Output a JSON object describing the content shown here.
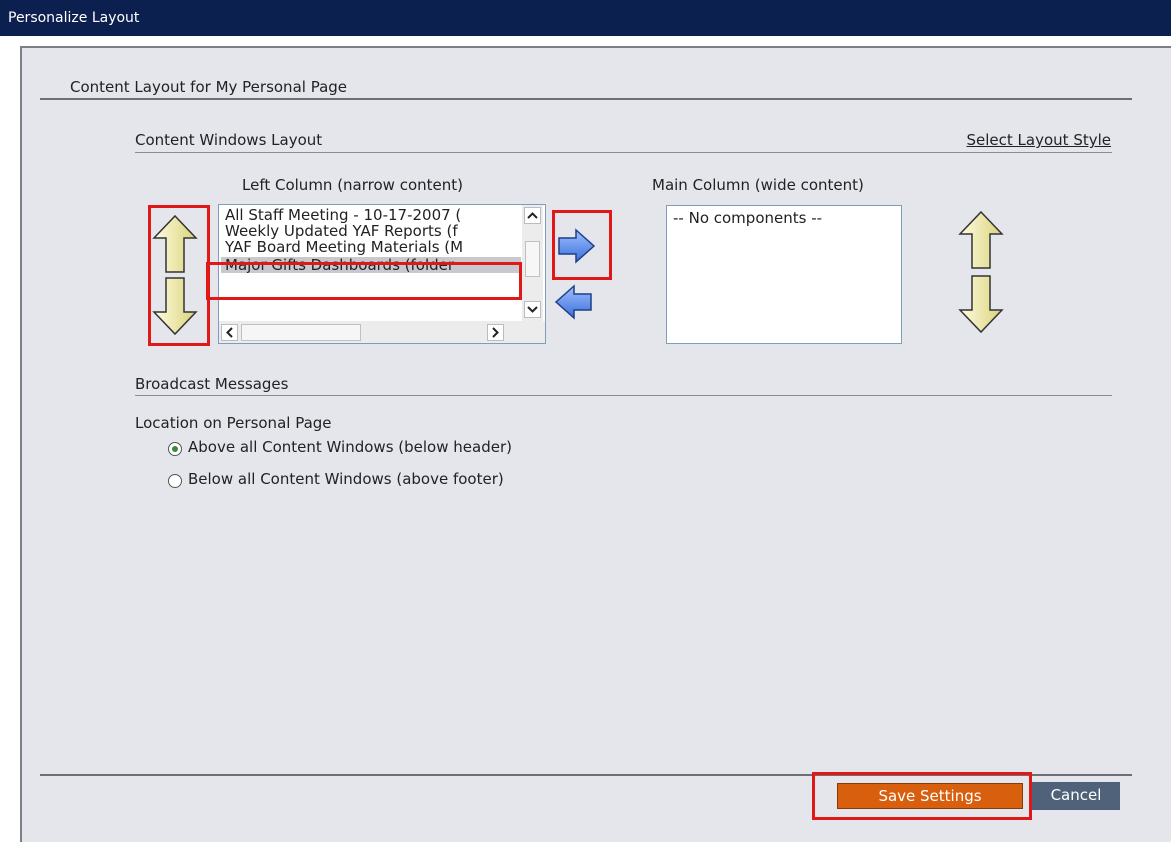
{
  "window": {
    "title": "Personalize Layout"
  },
  "section": {
    "title": "Content Layout for My Personal Page"
  },
  "content_windows": {
    "heading": "Content Windows Layout",
    "select_style_link": "Select Layout Style",
    "left_column": {
      "label": "Left Column (narrow content)",
      "items": [
        "All Staff Meeting - 10-17-2007 (",
        "Weekly Updated YAF Reports (f",
        "YAF Board Meeting Materials (M",
        "Major Gifts Dashboards (folder"
      ],
      "selected_index": 3
    },
    "main_column": {
      "label": "Main Column (wide content)",
      "items": [
        "-- No components --"
      ]
    }
  },
  "broadcast": {
    "heading": "Broadcast Messages",
    "location_label": "Location on Personal Page",
    "options": [
      {
        "label": "Above all Content Windows (below header)",
        "checked": true
      },
      {
        "label": "Below all Content Windows (above footer)",
        "checked": false
      }
    ]
  },
  "footer": {
    "save_label": "Save Settings",
    "cancel_label": "Cancel"
  },
  "colors": {
    "titlebar": "#0c2050",
    "panel": "#e4e6ec",
    "save": "#d85f0e",
    "cancel": "#50627a",
    "highlight": "#e01818",
    "move_arrow": "#4f7fe0",
    "order_arrow": "#f5f2b0"
  },
  "icons": {
    "move_up": "arrow-up-icon",
    "move_down": "arrow-down-icon",
    "move_right": "arrow-right-icon",
    "move_left": "arrow-left-icon"
  }
}
